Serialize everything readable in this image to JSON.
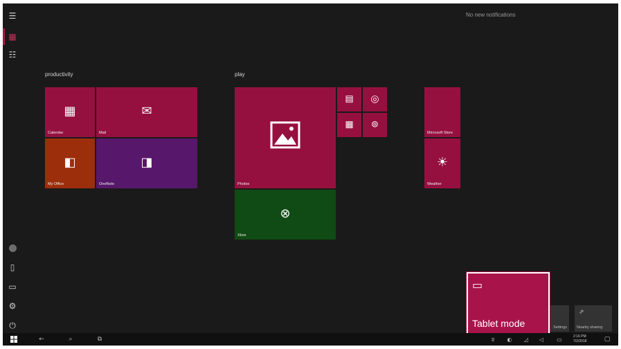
{
  "notifications": {
    "empty_text": "No new notifications"
  },
  "rail": {
    "icons": [
      "hamburger-menu-icon",
      "pinned-tiles-icon",
      "all-apps-icon",
      "user-avatar-icon",
      "documents-icon",
      "pictures-icon",
      "settings-icon",
      "power-icon"
    ]
  },
  "groups": {
    "productivity": "productivity",
    "play": "play"
  },
  "tiles": {
    "calendar": {
      "label": "Calendar",
      "icon": "calendar-icon"
    },
    "mail": {
      "label": "Mail",
      "icon": "mail-icon"
    },
    "my_office": {
      "label": "My Office",
      "icon": "office-icon"
    },
    "onenote": {
      "label": "OneNote",
      "icon": "onenote-icon"
    },
    "photos": {
      "label": "Photos",
      "icon": "photos-icon"
    },
    "movies": {
      "label": "",
      "icon": "movies-icon"
    },
    "groove": {
      "label": "",
      "icon": "music-icon"
    },
    "calculator": {
      "label": "",
      "icon": "calculator-icon"
    },
    "camera": {
      "label": "",
      "icon": "camera-icon"
    },
    "xbox": {
      "label": "Xbox",
      "icon": "xbox-icon"
    },
    "store": {
      "label": "Microsoft Store",
      "icon": "store-icon"
    },
    "weather": {
      "label": "Weather",
      "icon": "sun-icon"
    }
  },
  "quick_actions": {
    "settings": {
      "label": "Settings"
    },
    "nearby_sharing": {
      "label": "Nearby sharing"
    },
    "tablet_mode": {
      "label": "Tablet mode",
      "icon": "tablet-mode-icon"
    }
  },
  "taskbar": {
    "clock_time": "2:16 PM",
    "clock_date": "7/2/2018"
  },
  "colors": {
    "accent": "#a8144a",
    "tile_crimson": "#96103f",
    "tile_orange": "#9c2e0c",
    "tile_purple": "#57176a",
    "tile_green": "#104a14",
    "background": "#1a1a1a"
  }
}
